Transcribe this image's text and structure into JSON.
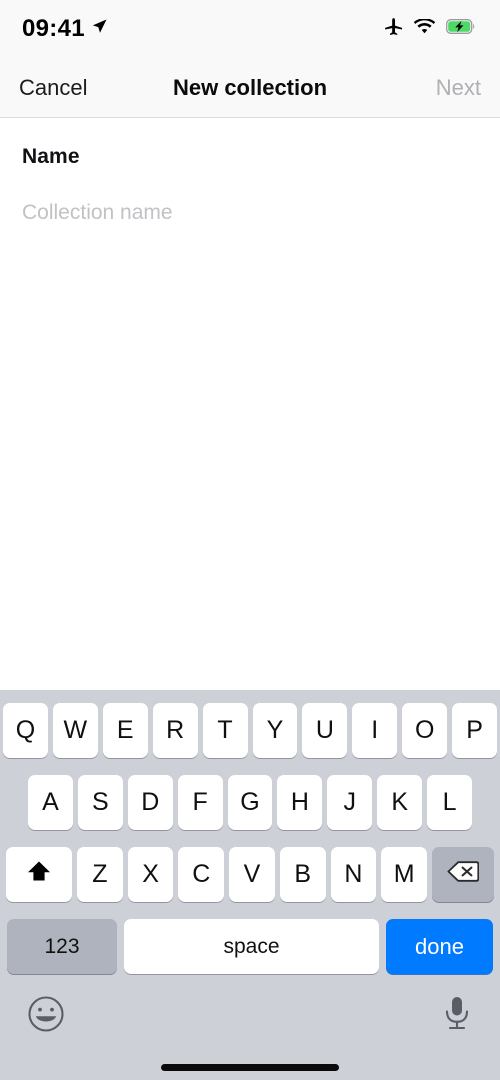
{
  "status_bar": {
    "time": "09:41",
    "icons": [
      "location-arrow-icon",
      "airplane-mode-icon",
      "wifi-icon",
      "battery-charging-icon"
    ],
    "battery_color": "#4cd964",
    "background": "#f9f9f9"
  },
  "nav_bar": {
    "cancel_label": "Cancel",
    "title": "New collection",
    "next_label": "Next",
    "next_disabled_color": "#b0b0b4"
  },
  "form": {
    "name_label": "Name",
    "name_value": "",
    "name_placeholder": "Collection name"
  },
  "keyboard": {
    "accent_color": "#007aff",
    "background": "#cdd0d7",
    "row1": [
      "Q",
      "W",
      "E",
      "R",
      "T",
      "Y",
      "U",
      "I",
      "O",
      "P"
    ],
    "row2": [
      "A",
      "S",
      "D",
      "F",
      "G",
      "H",
      "J",
      "K",
      "L"
    ],
    "row3": [
      "Z",
      "X",
      "C",
      "V",
      "B",
      "N",
      "M"
    ],
    "shift_icon": "shift-up-arrow-icon",
    "backspace_icon": "backspace-delete-icon",
    "numbers_label": "123",
    "space_label": "space",
    "done_label": "done",
    "emoji_icon": "emoji-smiley-icon",
    "dictation_icon": "microphone-icon"
  }
}
